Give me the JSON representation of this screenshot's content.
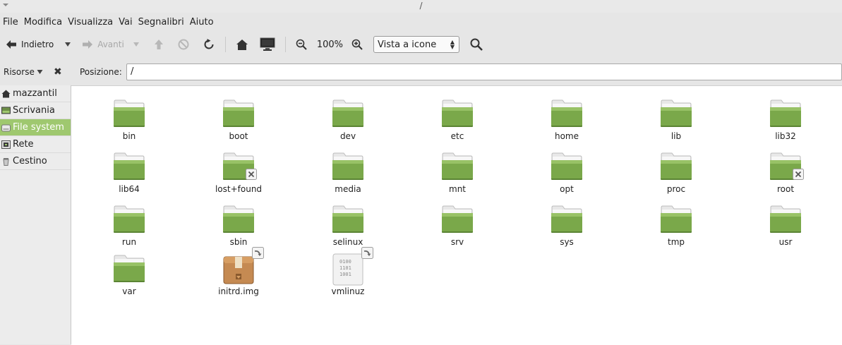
{
  "window": {
    "title": "/"
  },
  "menu": [
    "File",
    "Modifica",
    "Visualizza",
    "Vai",
    "Segnalibri",
    "Aiuto"
  ],
  "toolbar": {
    "back_label": "Indietro",
    "forward_label": "Avanti",
    "zoom_level": "100%",
    "view_mode": "Vista a icone"
  },
  "sidebar": {
    "header": "Risorse",
    "items": [
      {
        "label": "mazzantil",
        "icon": "home-icon"
      },
      {
        "label": "Scrivania",
        "icon": "desktop-icon"
      },
      {
        "label": "File system",
        "icon": "drive-icon",
        "active": true
      },
      {
        "label": "Rete",
        "icon": "network-icon"
      },
      {
        "label": "Cestino",
        "icon": "trash-icon"
      }
    ]
  },
  "location": {
    "label": "Posizione:",
    "value": "/"
  },
  "files": [
    {
      "name": "bin",
      "type": "folder"
    },
    {
      "name": "boot",
      "type": "folder"
    },
    {
      "name": "dev",
      "type": "folder"
    },
    {
      "name": "etc",
      "type": "folder"
    },
    {
      "name": "home",
      "type": "folder"
    },
    {
      "name": "lib",
      "type": "folder"
    },
    {
      "name": "lib32",
      "type": "folder"
    },
    {
      "name": "lib64",
      "type": "folder"
    },
    {
      "name": "lost+found",
      "type": "folder",
      "emblem": "locked"
    },
    {
      "name": "media",
      "type": "folder"
    },
    {
      "name": "mnt",
      "type": "folder"
    },
    {
      "name": "opt",
      "type": "folder"
    },
    {
      "name": "proc",
      "type": "folder"
    },
    {
      "name": "root",
      "type": "folder",
      "emblem": "locked"
    },
    {
      "name": "run",
      "type": "folder"
    },
    {
      "name": "sbin",
      "type": "folder"
    },
    {
      "name": "selinux",
      "type": "folder"
    },
    {
      "name": "srv",
      "type": "folder"
    },
    {
      "name": "sys",
      "type": "folder"
    },
    {
      "name": "tmp",
      "type": "folder"
    },
    {
      "name": "usr",
      "type": "folder"
    },
    {
      "name": "var",
      "type": "folder"
    },
    {
      "name": "initrd.img",
      "type": "package",
      "emblem": "symlink"
    },
    {
      "name": "vmlinuz",
      "type": "binary",
      "emblem": "symlink",
      "icon_text": [
        "0100",
        "1101",
        "1001"
      ]
    }
  ],
  "colors": {
    "folder": "#7aa84a",
    "selection": "#9fc86f"
  }
}
